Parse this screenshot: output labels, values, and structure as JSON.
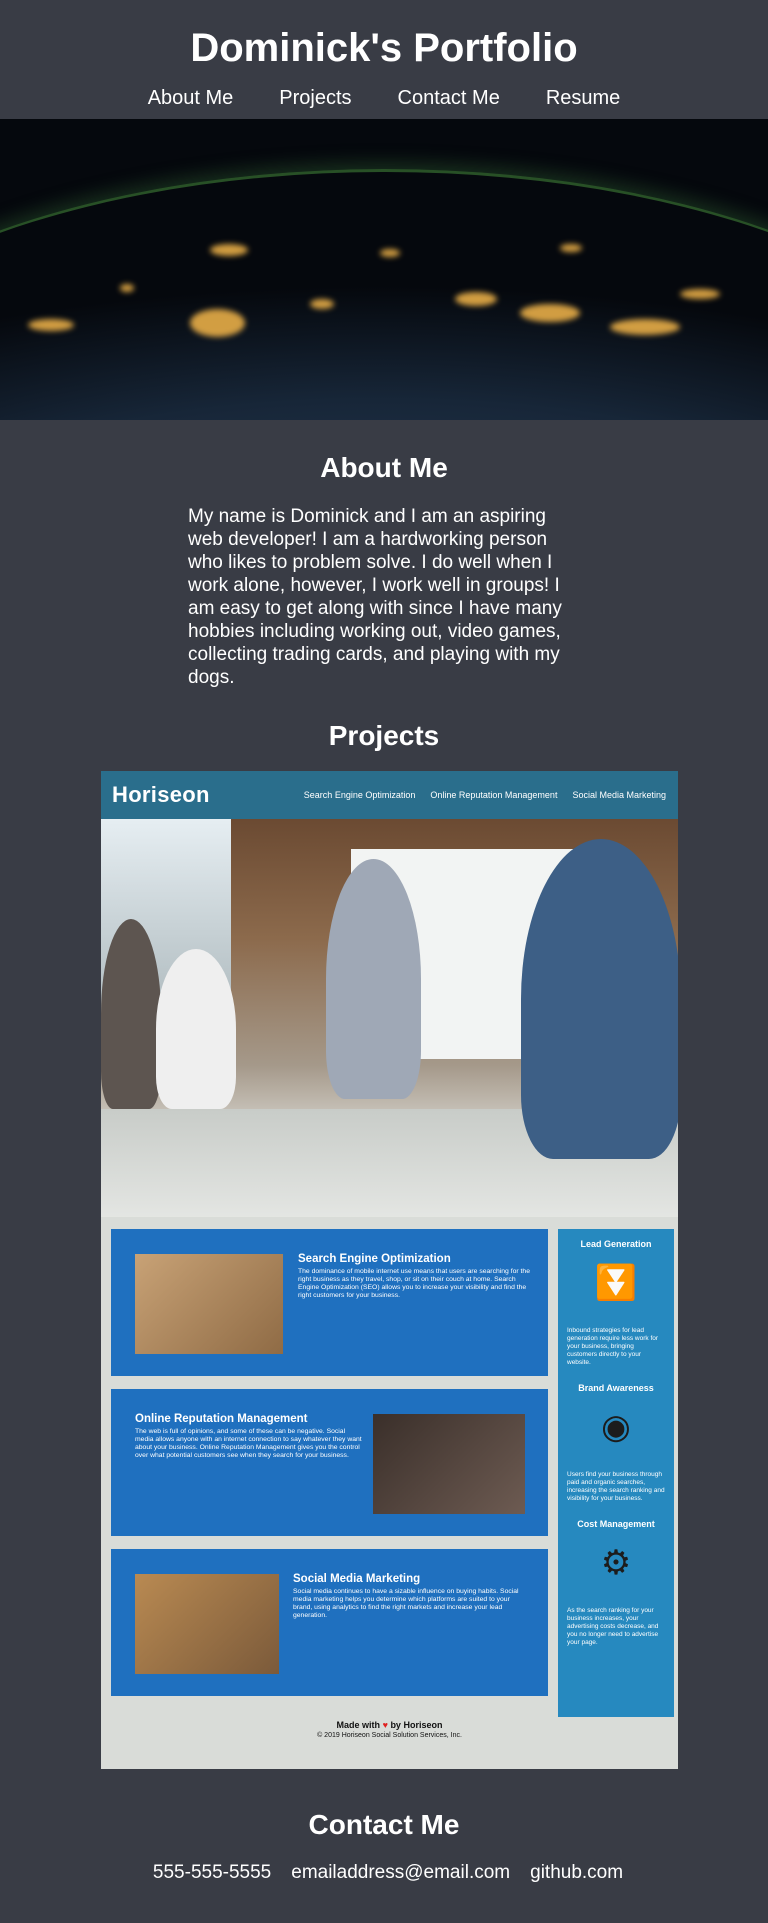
{
  "header": {
    "title": "Dominick's Portfolio",
    "nav": [
      "About Me",
      "Projects",
      "Contact Me",
      "Resume"
    ]
  },
  "about": {
    "heading": "About Me",
    "text": "My name is Dominick and I am an aspiring web developer! I am a hardworking person who likes to problem solve. I do well when I work alone, however, I work well in groups! I am easy to get along with since I have many hobbies including working out, video games, collecting trading cards, and playing with my dogs."
  },
  "projects": {
    "heading": "Projects",
    "horiseon": {
      "logo": "Horiseon",
      "nav": [
        "Search Engine Optimization",
        "Online Reputation Management",
        "Social Media Marketing"
      ],
      "cards": [
        {
          "title": "Search Engine Optimization",
          "text": "The dominance of mobile internet use means that users are searching for the right business as they travel, shop, or sit on their couch at home. Search Engine Optimization (SEO) allows you to increase your visibility and find the right customers for your business."
        },
        {
          "title": "Online Reputation Management",
          "text": "The web is full of opinions, and some of these can be negative. Social media allows anyone with an internet connection to say whatever they want about your business. Online Reputation Management gives you the control over what potential customers see when they search for your business."
        },
        {
          "title": "Social Media Marketing",
          "text": "Social media continues to have a sizable influence on buying habits. Social media marketing helps you determine which platforms are suited to your brand, using analytics to find the right markets and increase your lead generation."
        }
      ],
      "sidebar": [
        {
          "title": "Lead Generation",
          "text": "Inbound strategies for lead generation require less work for your business, bringing customers directly to your website."
        },
        {
          "title": "Brand Awareness",
          "text": "Users find your business through paid and organic searches, increasing the search ranking and visibility for your business."
        },
        {
          "title": "Cost Management",
          "text": "As the search ranking for your business increases, your advertising costs decrease, and you no longer need to advertise your page."
        }
      ],
      "footer": {
        "made_prefix": "Made with",
        "made_suffix": "by Horiseon",
        "copyright": "© 2019 Horiseon Social Solution Services, Inc."
      }
    }
  },
  "contact": {
    "heading": "Contact Me",
    "phone": "555-555-5555",
    "email": "emailaddress@email.com",
    "github": "github.com"
  }
}
